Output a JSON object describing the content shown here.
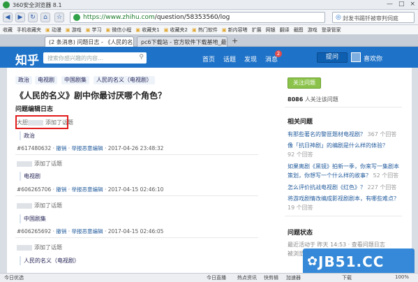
{
  "browser": {
    "title": "360安全浏览器 8.1",
    "url_host": "https://www.zhihu.com",
    "url_path": "/question/58353560/log",
    "search_text": "封发书踢钎被审判伺庭",
    "bookmarks": [
      "收藏",
      "手机收藏夹",
      "动漫",
      "游戏",
      "学习",
      "微信小程",
      "收藏夹1",
      "收藏夹2",
      "热门软件",
      "新内容嗒"
    ],
    "bookmark_right": [
      "扩展",
      "网银",
      "翻译",
      "截图",
      "游戏",
      "登录管家"
    ],
    "tabs": [
      "(2 条消息) 问题日志 - 《人民的名义",
      "pc6下载站 - 官方软件下载基地_最安"
    ],
    "window_buttons": [
      "—",
      "□",
      "×"
    ]
  },
  "site": {
    "logo": "知乎",
    "search_placeholder": "搜索你感兴趣的内容...",
    "nav": [
      "首页",
      "话题",
      "发现",
      "消息"
    ],
    "msg_badge": "2",
    "ask_button": "提问",
    "user_name": "喜欢你"
  },
  "question": {
    "tags": [
      "政治",
      "电视剧",
      "中国剧集",
      "人民的名义（电视剧）"
    ],
    "title": "《人民的名义》剧中你最讨厌哪个角色？",
    "log_title": "问题编辑日志",
    "entries": [
      {
        "who": "大胆",
        "action": "添加了话题",
        "chip": "政治",
        "id": "#617480632",
        "undo": "撤销",
        "report": "举报恶意编辑",
        "date": "· 2017-04-26 23:48:32"
      },
      {
        "who": "",
        "action": "添加了话题",
        "chip": "电视剧",
        "id": "#606265706",
        "undo": "撤销",
        "report": "举报恶意编辑",
        "date": "· 2017-04-15 02:46:10"
      },
      {
        "who": "",
        "action": "添加了话题",
        "chip": "中国剧集",
        "id": "#606265692",
        "undo": "撤销",
        "report": "举报恶意编辑",
        "date": "· 2017-04-15 02:46:05"
      },
      {
        "who": "",
        "action": "添加了话题",
        "chip": "人民的名义（电视剧）",
        "id": "",
        "undo": "",
        "report": "",
        "date": ""
      }
    ]
  },
  "sidebar": {
    "follow_button": "关注问题",
    "follow_count": "8086",
    "follow_suffix": "人关注该问题",
    "related_title": "相关问题",
    "related": [
      {
        "q": "有那些著名的警匪题材电视剧？",
        "c": "367 个回答"
      },
      {
        "q": "像「抗日神剧」的编剧是什么样的体验？",
        "c": ""
      },
      {
        "q": "",
        "c": "92 个回答"
      },
      {
        "q": "如果离剧《黑镜》拍新一季，你来写一集剧本",
        "c": ""
      },
      {
        "q": "策划，你想写一个什么样的故事？",
        "c": "52 个回答"
      },
      {
        "q": "怎么评价抗战电视剧《红色》？",
        "c": "227 个回答"
      },
      {
        "q": "将游戏剧情改编成影视剧剧本，有哪些难点？",
        "c": ""
      },
      {
        "q": "",
        "c": "19 个回答"
      }
    ],
    "status_title": "问题状态",
    "status_line1": "最近活动于 昨天 14:53 · 查看问题日志",
    "status_line2": "被浏览 1"
  },
  "statusbar": {
    "left": "今日优选",
    "items": [
      "今日直播",
      "热点资讯",
      "快剪辑",
      "加速器",
      "下载",
      "100%"
    ]
  },
  "watermark": "JB51.CC",
  "colors": {
    "brand": "#1e72c8",
    "follow": "#8bc34a",
    "highlight": "#e21b1b"
  }
}
